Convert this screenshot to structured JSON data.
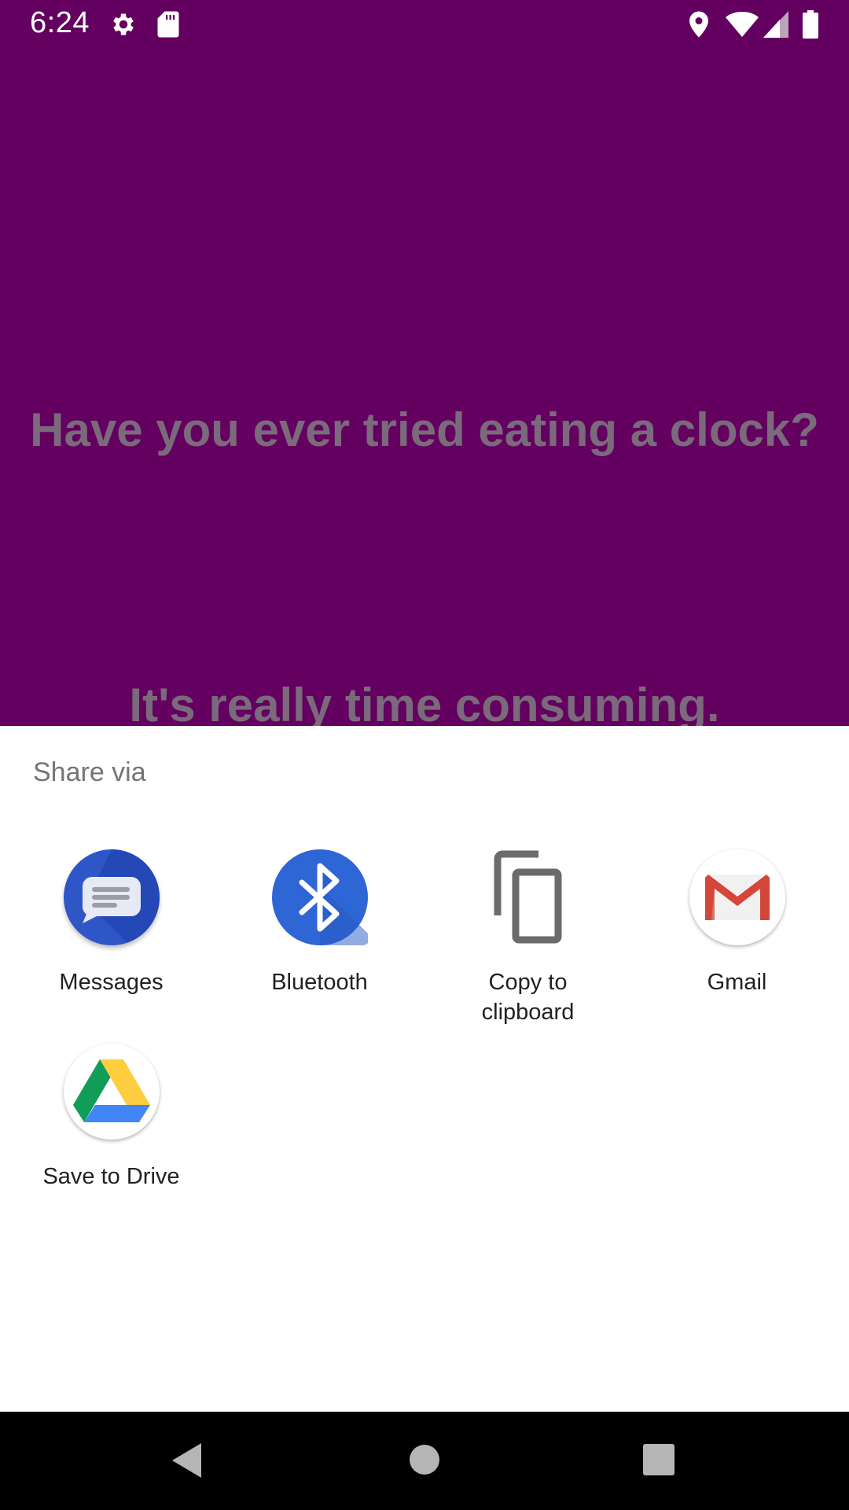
{
  "status_bar": {
    "time": "6:24",
    "icons_left": [
      "settings-icon",
      "sd-card-icon"
    ],
    "icons_right": [
      "location-icon",
      "wifi-icon",
      "signal-icon",
      "battery-icon"
    ]
  },
  "app": {
    "background_color": "#640060",
    "joke_question": "Have you ever tried eating a clock?",
    "joke_answer": "It's really time consuming."
  },
  "share_sheet": {
    "title": "Share via",
    "targets": [
      {
        "label": "Messages",
        "icon": "messages-icon"
      },
      {
        "label": "Bluetooth",
        "icon": "bluetooth-icon"
      },
      {
        "label_line1": "Copy to",
        "label_line2": "clipboard",
        "icon": "copy-icon"
      },
      {
        "label": "Gmail",
        "icon": "gmail-icon"
      },
      {
        "label": "Save to Drive",
        "icon": "drive-icon"
      }
    ]
  },
  "nav_bar": {
    "buttons": [
      "back-icon",
      "home-icon",
      "recents-icon"
    ]
  }
}
